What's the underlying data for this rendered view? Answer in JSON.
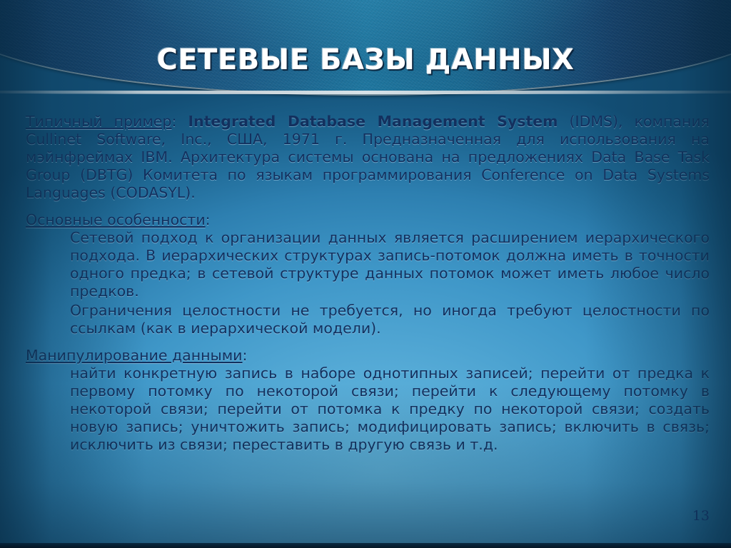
{
  "slide": {
    "title": "СЕТЕВЫЕ БАЗЫ ДАННЫХ",
    "number": "13",
    "colors": {
      "title_text": "#ffffff",
      "body_text": "#13305e",
      "banner_dark": "#0d2b4c",
      "banner_teal": "#1f7da6",
      "background_light": "#63b6dd",
      "background_dark": "#134f76"
    }
  },
  "content": {
    "intro": {
      "lead_label": "Типичный пример",
      "lead_colon": ": ",
      "product_bold": "Integrated Database Management System",
      "rest": " (IDMS), компания Cullinet Software, Inc., США, 1971 г. Предназначенная для использования на мэйнфреймах IBM. Архитектура системы основана на предложениях Data Base Task Group (DBTG) Комитета по языкам программирования Conference on Data Systems Languages (CODASYL)."
    },
    "features": {
      "heading": "Основные особенности",
      "heading_colon": ":",
      "paragraphs": [
        "Сетевой подход к организации данных является расширением иерархического подхода. В иерархических структурах запись-потомок должна иметь в точности одного предка; в сетевой структуре данных потомок может иметь любое число предков.",
        "Ограничения целостности не требуется, но иногда требуют целостности по ссылкам (как в иерархической модели)."
      ]
    },
    "manipulation": {
      "heading": "Манипулирование данными",
      "heading_colon": ":",
      "paragraphs": [
        "найти конкретную запись в наборе однотипных записей; перейти от предка к первому потомку по некоторой связи; перейти к следующему потомку в некоторой связи; перейти от потомка к предку по некоторой связи; создать новую запись; уничтожить запись; модифицировать запись; включить в связь; исключить из связи; переставить в другую связь и т.д."
      ]
    }
  }
}
